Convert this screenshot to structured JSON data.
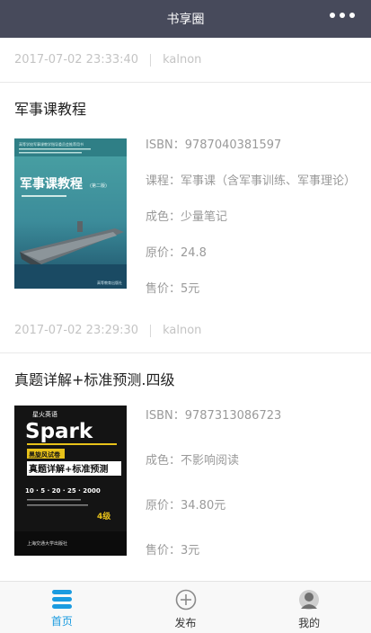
{
  "header": {
    "title": "书享圈"
  },
  "colors": {
    "header_bg": "#474a5b",
    "accent": "#1a9be0"
  },
  "posts": [
    {
      "date": "2017-07-02 23:33:40",
      "user": "kalnon",
      "title": "军事课教程",
      "cover": {
        "series_line": "高等学校军事课教学指导委员会推荐用书",
        "title": "军事课教程",
        "edition": "(第二版)",
        "publisher": "高等教育出版社"
      },
      "isbn": "ISBN：9787040381597",
      "course": "课程：军事课（含军事训练、军事理论）",
      "condition": "成色：少量笔记",
      "original_price": "原价：24.8",
      "price": "售价：5元"
    },
    {
      "date": "2017-07-02 23:29:30",
      "user": "kalnon",
      "title": "真题详解+标准预测.四级",
      "cover": {
        "brand_top": "星火英语",
        "brand": "Spark",
        "series": "黑旋风试卷",
        "title": "真题详解+标准预测",
        "counts": "10 · 5 · 20 · 25 · 2000",
        "level": "4级",
        "publisher": "上海交通大学出版社"
      },
      "isbn": "ISBN：9787313086723",
      "condition": "成色：不影响阅读",
      "original_price": "原价：34.80元",
      "price": "售价：3元"
    }
  ],
  "tabs": [
    {
      "label": "首页",
      "icon": "home-list-icon",
      "active": true
    },
    {
      "label": "发布",
      "icon": "add-circle-icon",
      "active": false
    },
    {
      "label": "我的",
      "icon": "user-icon",
      "active": false
    }
  ]
}
